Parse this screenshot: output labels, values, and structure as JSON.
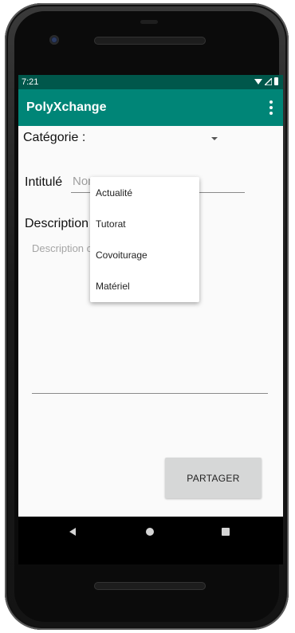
{
  "status_bar": {
    "time": "7:21"
  },
  "app_bar": {
    "title": "PolyXchange"
  },
  "form": {
    "category_label": "Catégorie :",
    "title_label": "Intitulé",
    "title_placeholder": "Nom",
    "description_label": "Description",
    "description_placeholder": "Description complète",
    "share_label": "PARTAGER"
  },
  "category_dropdown": {
    "options": [
      "Actualité",
      "Tutorat",
      "Covoiturage",
      "Matériel"
    ]
  },
  "colors": {
    "status_bar": "#00574b",
    "app_bar": "#008577",
    "button": "#d6d7d7",
    "screen_bg": "#fafafa"
  },
  "icons": {
    "overflow": "more-vert-icon",
    "wifi": "wifi-icon",
    "signal": "signal-icon",
    "battery": "battery-icon",
    "back": "back-icon",
    "home": "home-icon",
    "recents": "recents-icon"
  }
}
